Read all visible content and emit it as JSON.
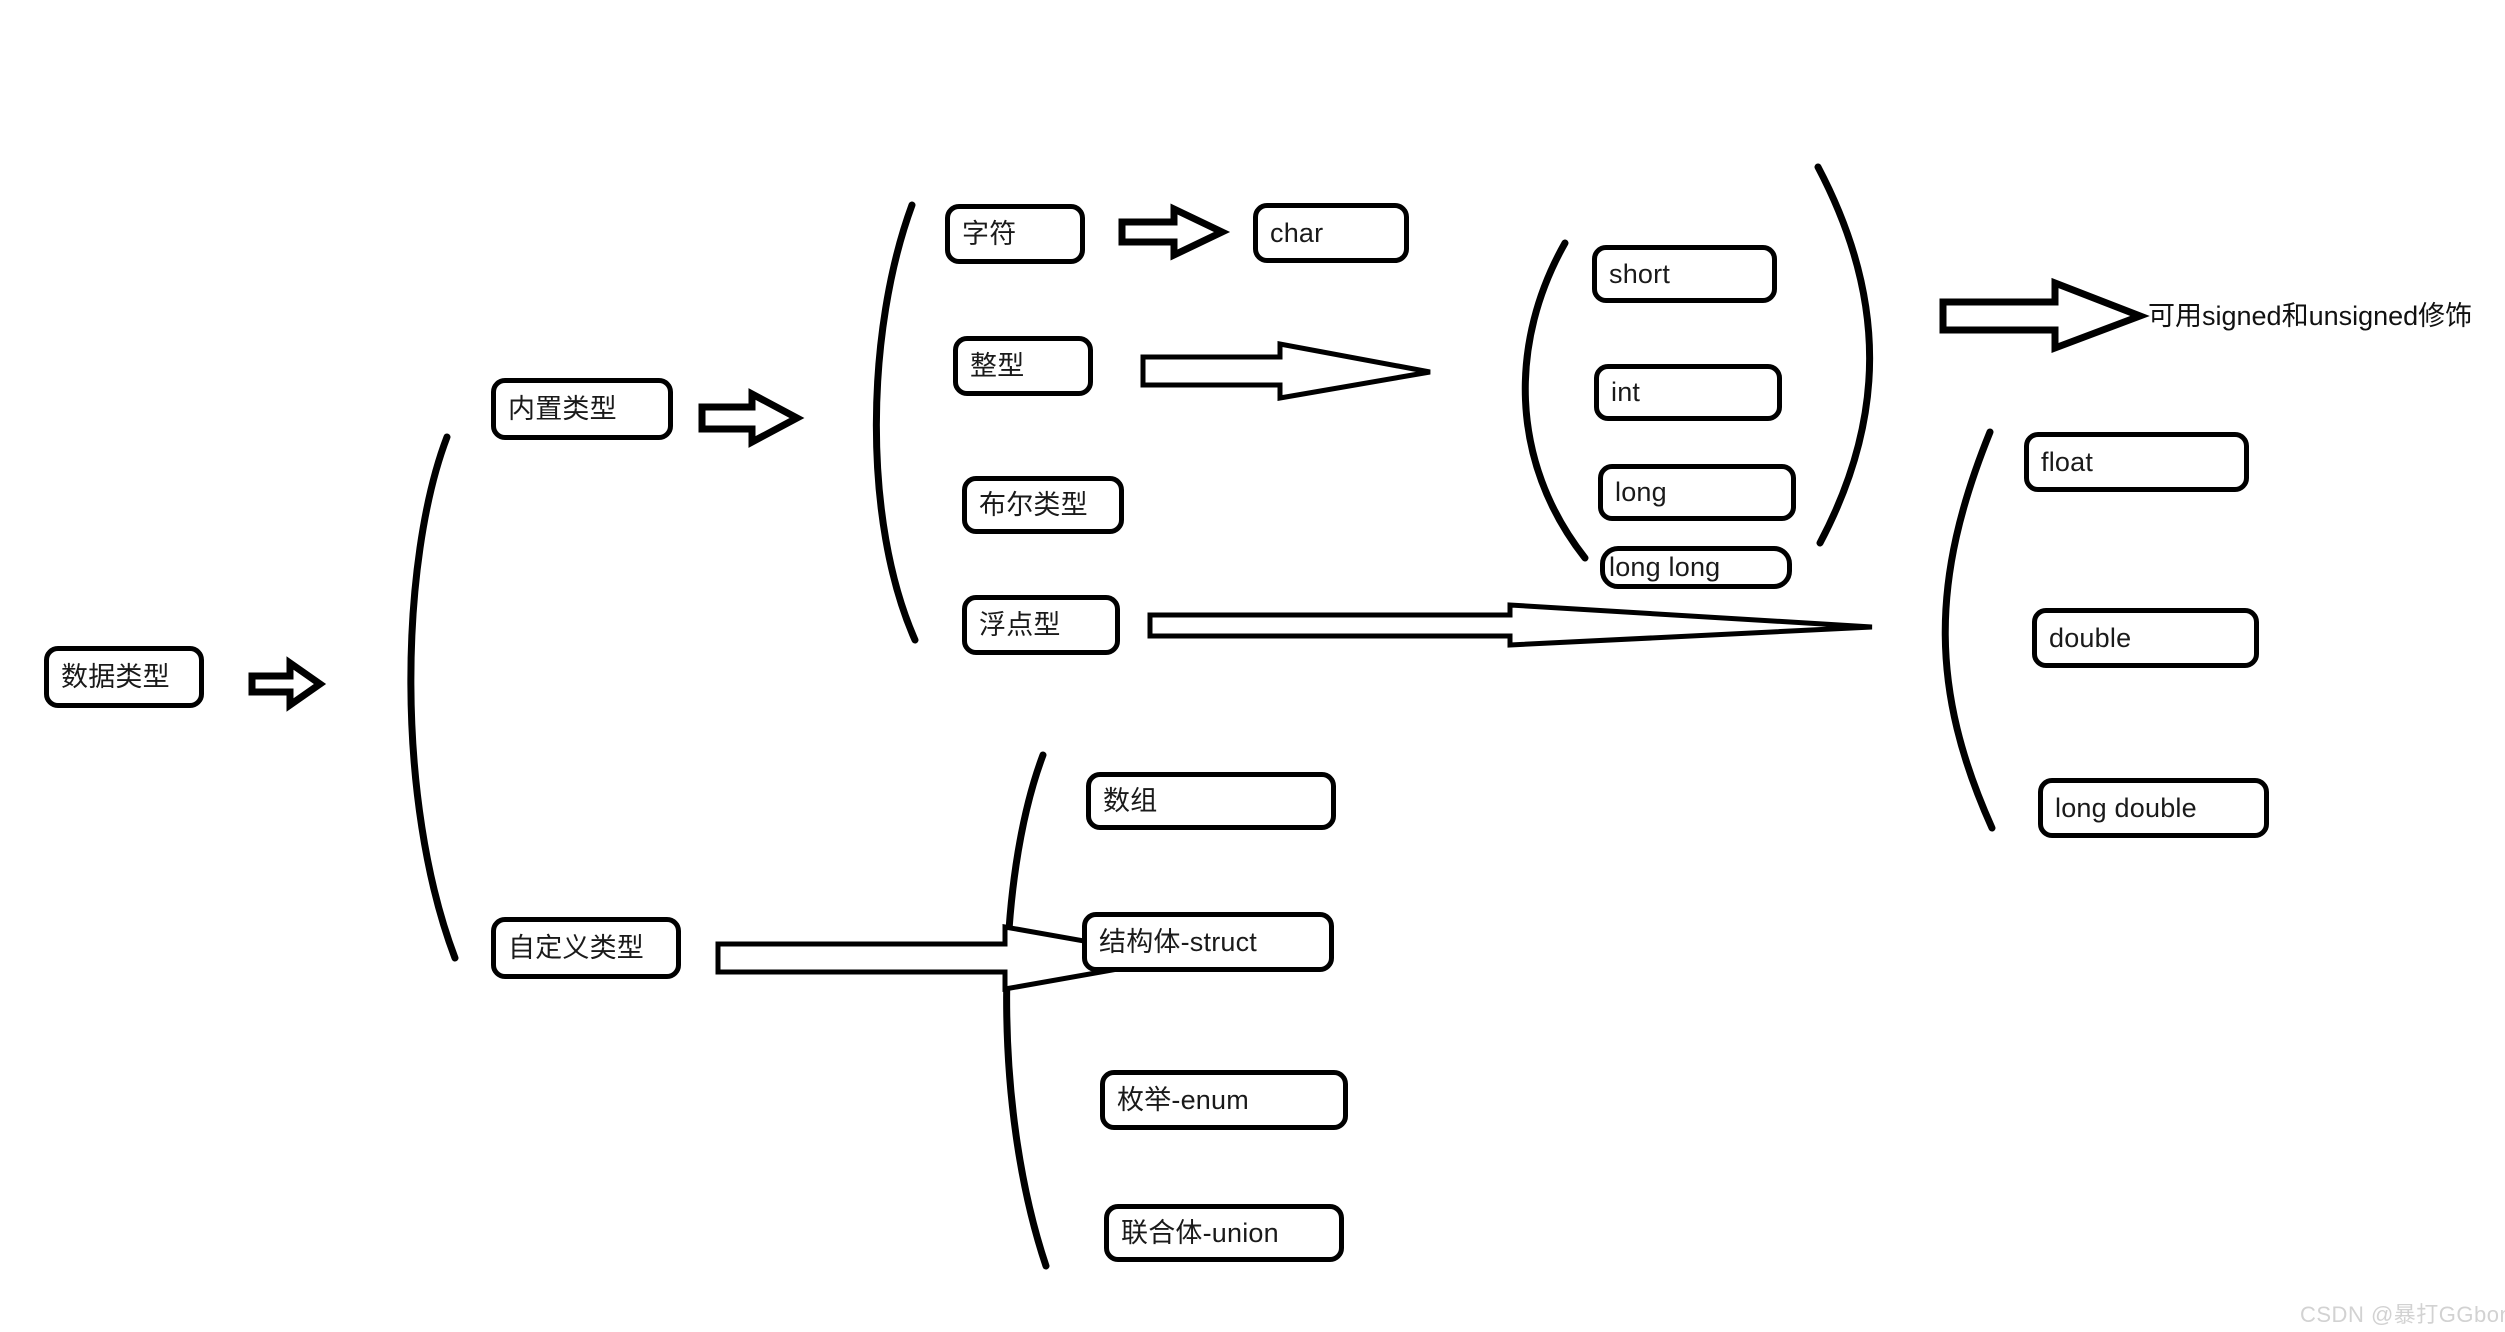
{
  "diagram": {
    "title_text": "数据类型",
    "root": {
      "label": "数据类型"
    },
    "level2": [
      {
        "label": "内置类型"
      },
      {
        "label": "自定义类型"
      }
    ],
    "builtin_categories": [
      {
        "label": "字符"
      },
      {
        "label": "整型"
      },
      {
        "label": "布尔类型"
      },
      {
        "label": "浮点型"
      }
    ],
    "char_types": [
      {
        "label": "char"
      }
    ],
    "integer_types": [
      {
        "label": "short"
      },
      {
        "label": "int"
      },
      {
        "label": "long"
      },
      {
        "label": "long long"
      }
    ],
    "integer_note": "可用signed和unsigned修饰",
    "float_types": [
      {
        "label": "float"
      },
      {
        "label": "double"
      },
      {
        "label": "long double"
      }
    ],
    "custom_types": [
      {
        "label": "数组"
      },
      {
        "label": "结构体-struct"
      },
      {
        "label": "枚举-enum"
      },
      {
        "label": "联合体-union"
      }
    ]
  },
  "watermark": {
    "text": "CSDN @暴打GGbond"
  },
  "colors": {
    "stroke": "#000000",
    "text": "#1a1a1a",
    "background": "#ffffff",
    "watermark": "#d2d2d2"
  }
}
